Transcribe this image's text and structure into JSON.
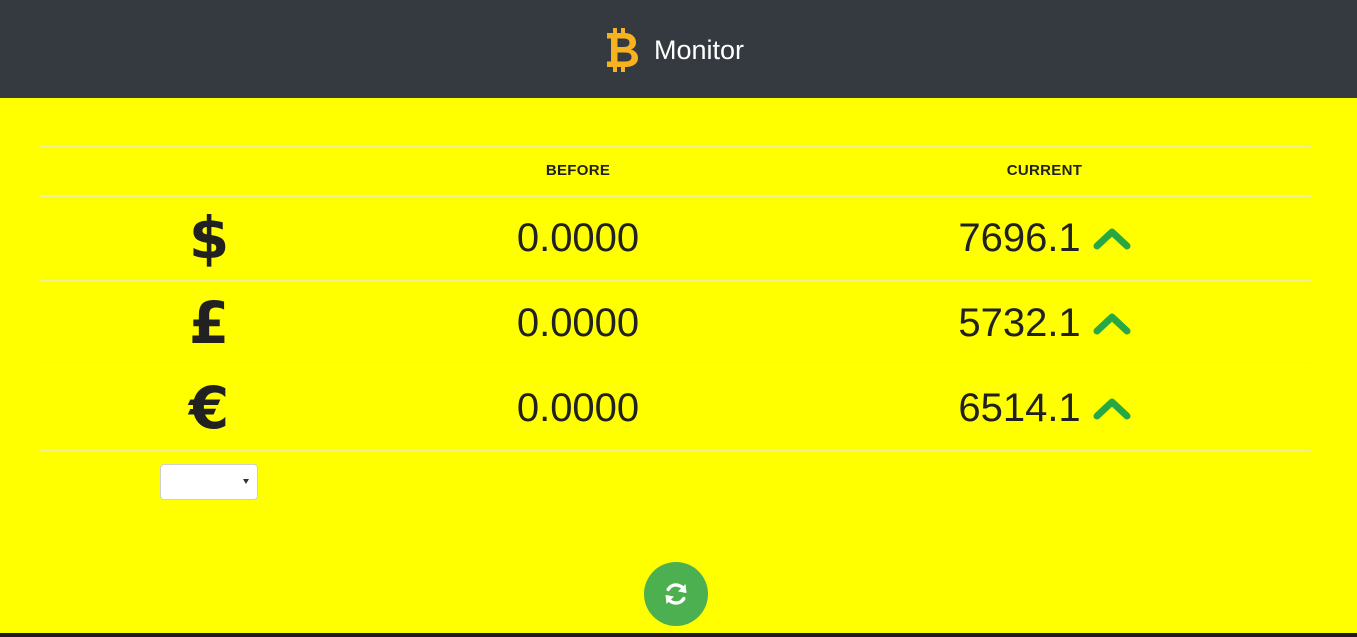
{
  "header": {
    "logo_icon": "bitcoin-icon",
    "title": "Monitor",
    "background": "#343a40",
    "logo_color": "#f7b21f"
  },
  "main": {
    "background": "#ffff00"
  },
  "table": {
    "columns": [
      "",
      "BEFORE",
      "CURRENT"
    ],
    "rows": [
      {
        "currency": "USD",
        "symbol": "$",
        "before": "0.0000",
        "current": "7696.1",
        "trend": "up"
      },
      {
        "currency": "GBP",
        "symbol": "£",
        "before": "0.0000",
        "current": "5732.1",
        "trend": "up"
      },
      {
        "currency": "EUR",
        "symbol": "€",
        "before": "0.0000",
        "current": "6514.1",
        "trend": "up"
      }
    ],
    "trend_icon": "chevron-up-icon",
    "trend_color": "#28a745"
  },
  "selector": {
    "value": ""
  },
  "refresh_button": {
    "icon": "refresh-icon",
    "color": "#4caf50"
  }
}
